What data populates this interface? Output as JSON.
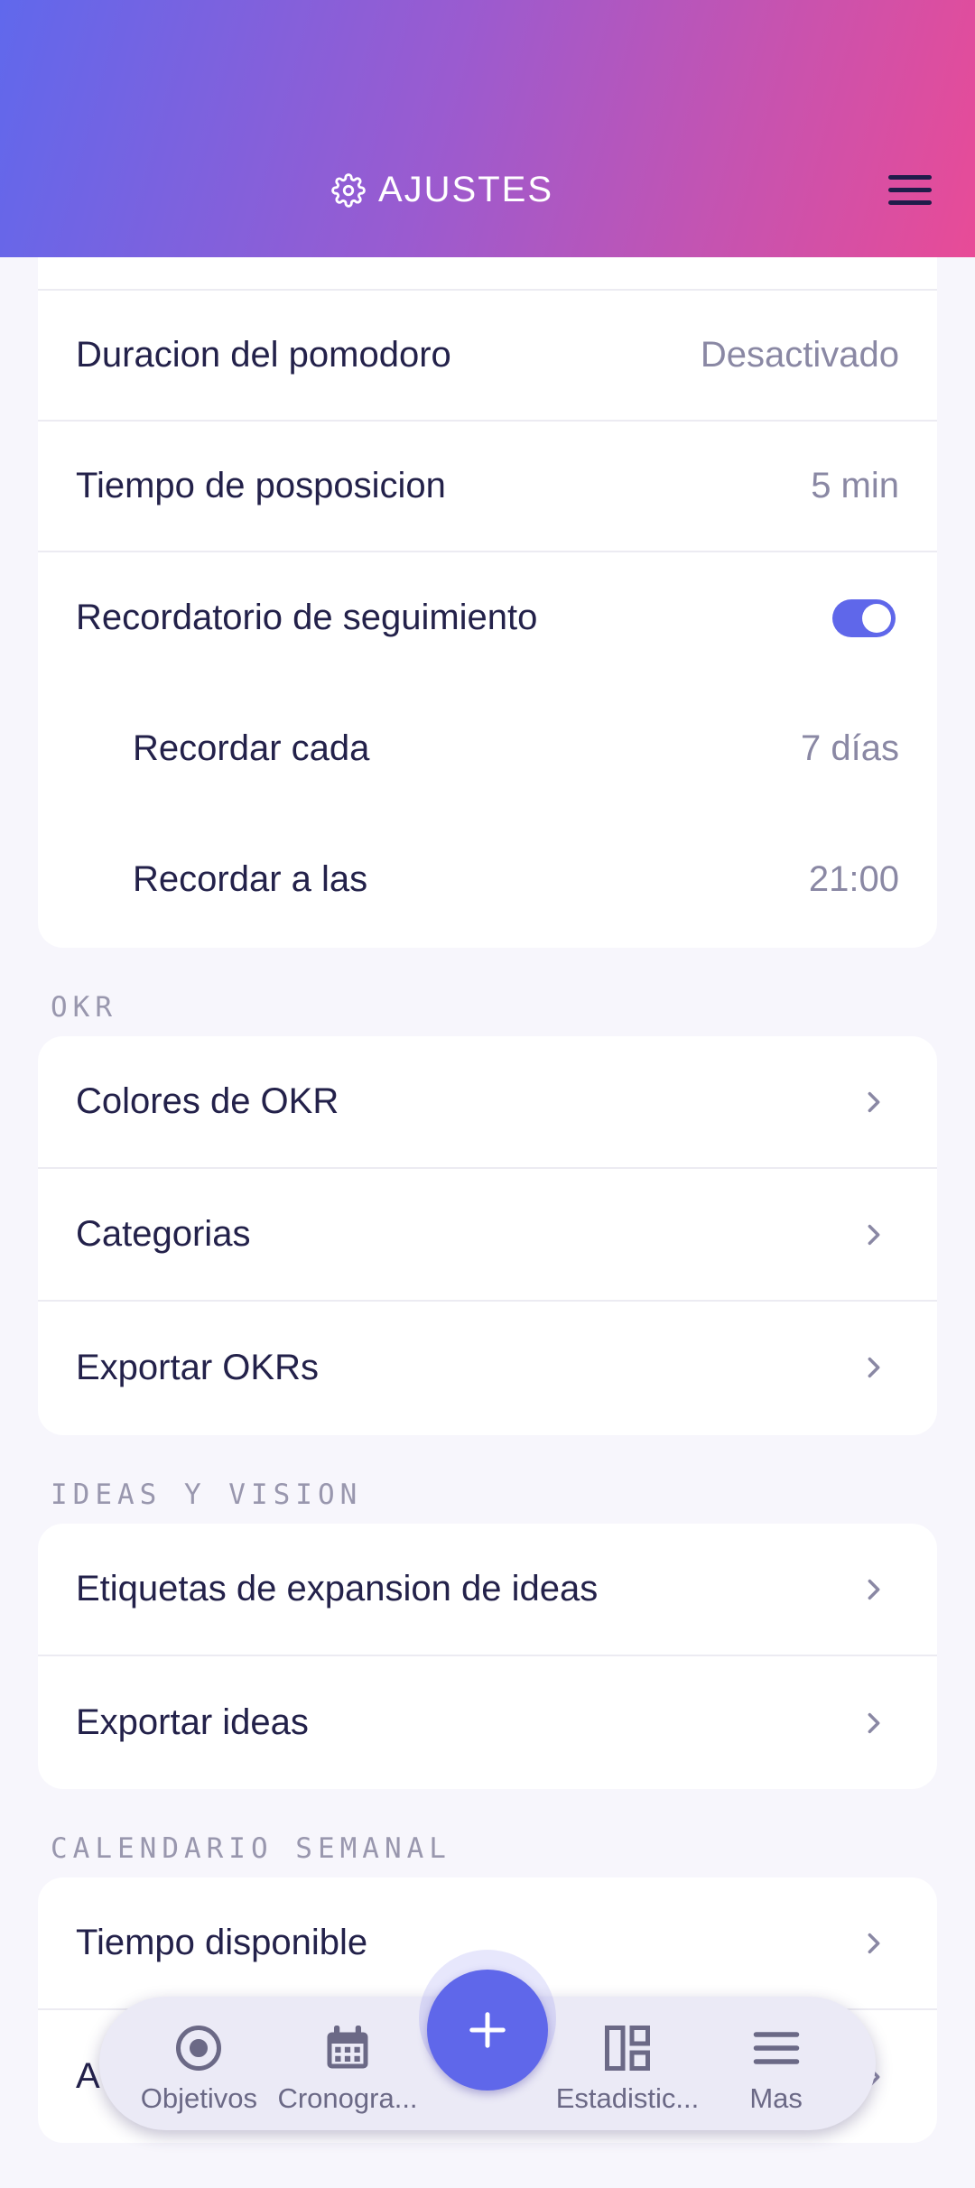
{
  "header": {
    "title": "AJUSTES"
  },
  "sections": {
    "pomodoro": {
      "duration_label": "Duracion del pomodoro",
      "duration_value": "Desactivado",
      "snooze_label": "Tiempo de posposicion",
      "snooze_value": "5 min",
      "followup_label": "Recordatorio de seguimiento",
      "followup_enabled": true,
      "remind_every_label": "Recordar cada",
      "remind_every_value": "7 días",
      "remind_at_label": "Recordar a las",
      "remind_at_value": "21:00"
    },
    "okr": {
      "title": "OKR",
      "items": [
        {
          "label": "Colores de OKR"
        },
        {
          "label": "Categorias"
        },
        {
          "label": "Exportar OKRs"
        }
      ]
    },
    "ideas": {
      "title": "IDEAS Y VISION",
      "items": [
        {
          "label": "Etiquetas de expansion de ideas"
        },
        {
          "label": "Exportar ideas"
        }
      ]
    },
    "calendar": {
      "title": "CALENDARIO SEMANAL",
      "items": [
        {
          "label": "Tiempo disponible"
        },
        {
          "label": "A"
        }
      ]
    }
  },
  "bottom_nav": {
    "items": [
      {
        "label": "Objetivos",
        "icon": "target-icon"
      },
      {
        "label": "Cronogra...",
        "icon": "calendar-icon"
      },
      {
        "label": "Estadistic...",
        "icon": "dashboard-icon"
      },
      {
        "label": "Mas",
        "icon": "menu-icon"
      }
    ],
    "fab_icon": "plus-icon"
  },
  "colors": {
    "accent": "#5f67ea",
    "header_gradient_start": "#6068ec",
    "header_gradient_end": "#e84b97",
    "text_primary": "#23214a",
    "text_secondary": "#8a88a4"
  }
}
